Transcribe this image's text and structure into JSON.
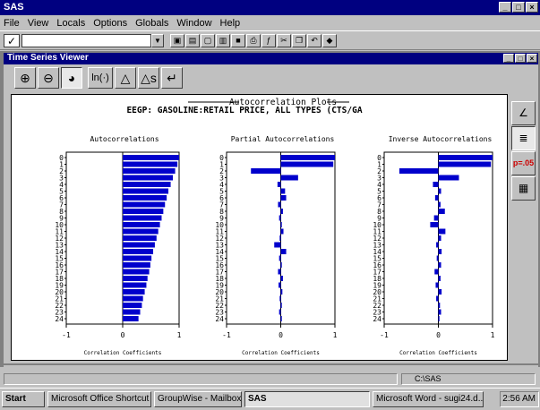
{
  "window": {
    "title": "SAS",
    "controls": [
      "_",
      "□",
      "×"
    ]
  },
  "menu": [
    "File",
    "View",
    "Locals",
    "Options",
    "Globals",
    "Window",
    "Help"
  ],
  "command_box": {
    "value": ""
  },
  "tsv": {
    "title": "Time Series Viewer"
  },
  "tools": [
    "⊕",
    "⊖",
    "◕",
    "ln(·)",
    "△",
    "△s",
    "↵"
  ],
  "side_tools": [
    "∠",
    "≣",
    "p=.05",
    "▦"
  ],
  "plot": {
    "title": "Autocorrelation Plots",
    "subtitle": "EEGP: GASOLINE:RETAIL PRICE, ALL TYPES (CTS/GA",
    "panels": [
      {
        "name": "Autocorrelations",
        "xlabel": "Correlation Coefficients"
      },
      {
        "name": "Partial Autocorrelations",
        "xlabel": "Correlation Coefficients"
      },
      {
        "name": "Inverse Autocorrelations",
        "xlabel": "Correlation Coefficients"
      }
    ]
  },
  "chart_data": {
    "type": "bar",
    "orientation": "horizontal",
    "lags": [
      0,
      1,
      2,
      3,
      4,
      5,
      6,
      7,
      8,
      9,
      10,
      11,
      12,
      13,
      14,
      15,
      16,
      17,
      18,
      19,
      20,
      21,
      22,
      23,
      24
    ],
    "xlim": [
      -1,
      1
    ],
    "xticks": [
      "-1",
      "0",
      "1"
    ],
    "series": [
      {
        "name": "Autocorrelations",
        "values": [
          1.0,
          0.97,
          0.93,
          0.89,
          0.85,
          0.81,
          0.78,
          0.75,
          0.72,
          0.69,
          0.66,
          0.63,
          0.6,
          0.57,
          0.54,
          0.51,
          0.49,
          0.47,
          0.44,
          0.42,
          0.39,
          0.36,
          0.34,
          0.31,
          0.28
        ]
      },
      {
        "name": "Partial Autocorrelations",
        "values": [
          1.0,
          0.97,
          -0.55,
          0.32,
          -0.06,
          0.08,
          0.1,
          -0.05,
          0.04,
          -0.03,
          0.02,
          0.05,
          -0.02,
          -0.12,
          0.1,
          -0.03,
          0.02,
          -0.05,
          0.04,
          -0.04,
          0.03,
          -0.02,
          0.02,
          -0.03,
          0.02
        ]
      },
      {
        "name": "Inverse Autocorrelations",
        "values": [
          1.0,
          0.97,
          -0.72,
          0.38,
          -0.1,
          0.05,
          -0.06,
          0.04,
          0.12,
          -0.08,
          -0.15,
          0.13,
          0.05,
          -0.04,
          0.06,
          -0.03,
          0.05,
          -0.07,
          0.04,
          -0.05,
          0.06,
          -0.04,
          0.03,
          0.05,
          0.02
        ]
      }
    ]
  },
  "status": {
    "path": "C:\\SAS"
  },
  "taskbar": {
    "start": "Start",
    "items": [
      "Microsoft Office Shortcut ...",
      "GroupWise - Mailbox",
      "SAS",
      "Microsoft Word - sugi24.d..."
    ],
    "clock": "2:56 AM"
  }
}
